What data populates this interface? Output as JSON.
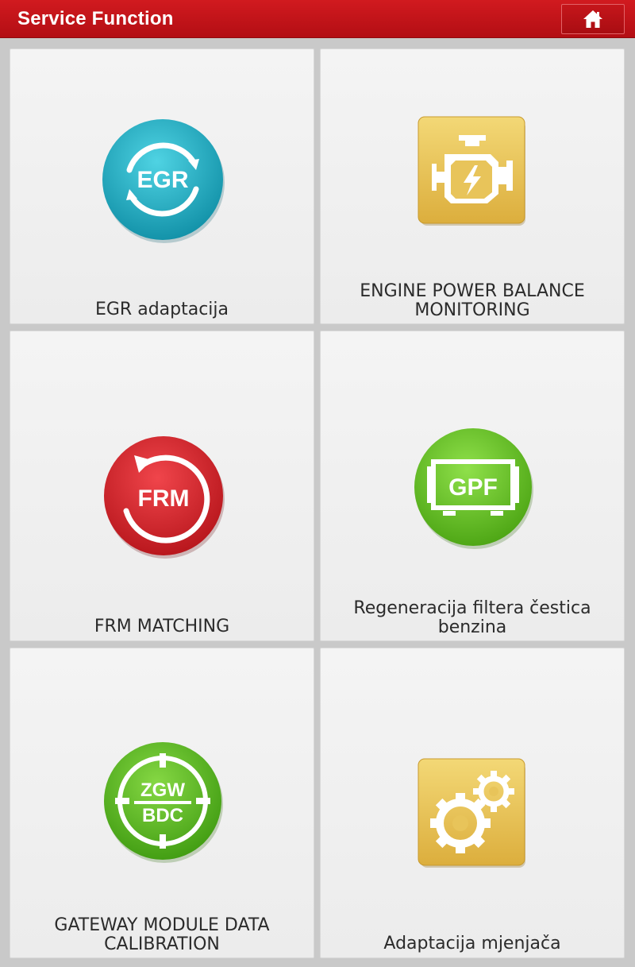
{
  "header": {
    "title": "Service Function",
    "home_icon": "home-icon"
  },
  "tiles": [
    {
      "label": "EGR adaptacija",
      "icon": "egr-icon",
      "icon_text": "EGR",
      "color": "#1aa8bf"
    },
    {
      "label": "ENGINE POWER BALANCE MONITORING",
      "icon": "engine-icon",
      "color": "#e8c45a"
    },
    {
      "label": "FRM MATCHING",
      "icon": "frm-icon",
      "icon_text": "FRM",
      "color": "#d8232a"
    },
    {
      "label": "Regeneracija filtera čestica benzina",
      "icon": "gpf-icon",
      "icon_text": "GPF",
      "color": "#5fbf1f"
    },
    {
      "label": "GATEWAY MODULE DATA CALIBRATION",
      "icon": "zgw-bdc-icon",
      "icon_text_top": "ZGW",
      "icon_text_bottom": "BDC",
      "color": "#4fb51c"
    },
    {
      "label": "Adaptacija mjenjača",
      "icon": "gears-icon",
      "color": "#e8c45a"
    }
  ],
  "colors": {
    "header_red": "#c4141a",
    "tile_bg": "#f0f0f0",
    "page_bg": "#c9c9c9"
  }
}
